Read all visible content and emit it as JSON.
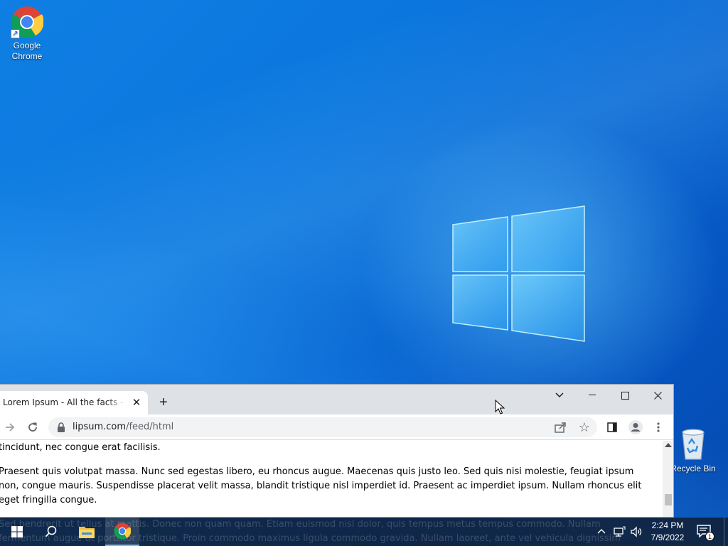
{
  "desktop": {
    "icons": [
      {
        "label_line1": "Google",
        "label_line2": "Chrome",
        "icon": "chrome-icon"
      },
      {
        "label": "Recycle Bin",
        "icon": "recycle-bin-icon"
      }
    ]
  },
  "browser": {
    "tab": {
      "title": "Lorem Ipsum - All the facts - Lipsum generator",
      "close": "✕"
    },
    "new_tab": "+",
    "window_controls": [
      "tab-search",
      "minimize",
      "maximize",
      "close"
    ],
    "address": {
      "host": "lipsum.com",
      "path": "/feed/html"
    },
    "content": {
      "paragraphs": [
        "tincidunt, nec congue erat facilisis.",
        "Praesent quis volutpat massa. Nunc sed egestas libero, eu rhoncus augue. Maecenas quis justo leo. Sed quis nisi molestie, feugiat ipsum",
        "non, congue mauris. Suspendisse placerat velit massa, blandit tristique nisl imperdiet id. Praesent ac imperdiet ipsum. Nullam rhoncus elit",
        "eget fringilla congue.",
        "Sed hendrerit ut tellus at mattis. Donec non quam quam. Etiam euismod nisl dolor, quis tempus metus tempus commodo. Nullam",
        "fermentum augue ut porttitor tristique. Proin commodo maximus ligula commodo gravida. Nullam laoreet, ante vel vehicula dignissim"
      ]
    }
  },
  "taskbar": {
    "clock": {
      "time": "2:24 PM",
      "date": "7/9/2022"
    },
    "notification_count": "1"
  },
  "colors": {
    "taskbar": "#101e34",
    "tab_strip": "#dee1e6",
    "accent": "#76b9ed"
  }
}
